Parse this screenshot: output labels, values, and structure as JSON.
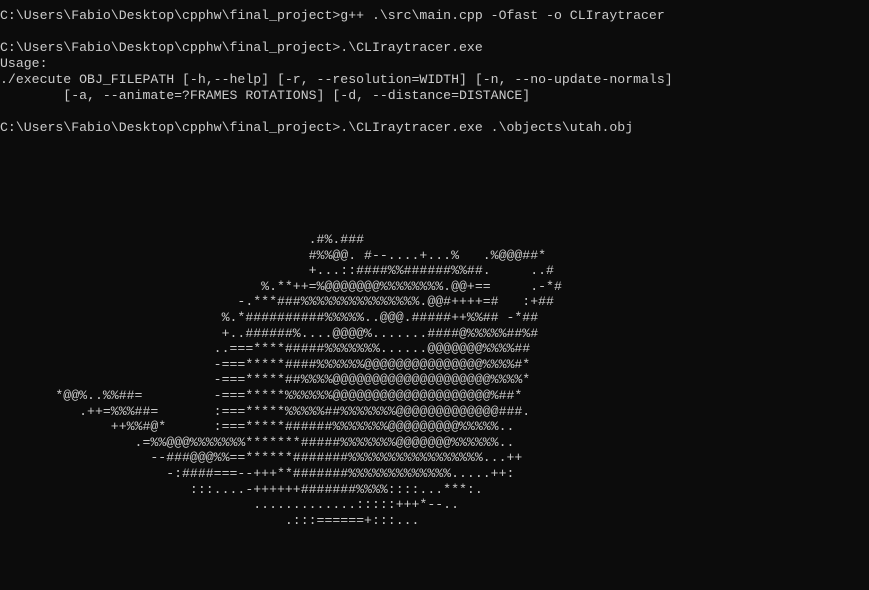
{
  "terminal": {
    "lines": [
      "C:\\Users\\Fabio\\Desktop\\cpphw\\final_project>g++ .\\src\\main.cpp -Ofast -o CLIraytracer",
      "",
      "C:\\Users\\Fabio\\Desktop\\cpphw\\final_project>.\\CLIraytracer.exe",
      "Usage:",
      "./execute OBJ_FILEPATH [-h,--help] [-r, --resolution=WIDTH] [-n, --no-update-normals]",
      "        [-a, --animate=?FRAMES ROTATIONS] [-d, --distance=DISTANCE]",
      "",
      "C:\\Users\\Fabio\\Desktop\\cpphw\\final_project>.\\CLIraytracer.exe .\\objects\\utah.obj"
    ],
    "ascii_render": [
      "                                       .#%.###",
      "                                       #%%@@. #--....+...%   .%@@@##*",
      "                                       +...::####%%######%%##.     ..#",
      "                                 %.**++=%@@@@@@@%%%%%%%%.@@+==     .-*#",
      "                              -.***###%%%%%%%%%%%%%%%.@@#++++=#   :+##",
      "                            %.*##########%%%%%..@@@.#####++%%## -*##",
      "                            +..######%....@@@@%.......####@%%%%%##%#",
      "                           ..===****#####%%%%%%%......@@@@@@@%%%%##",
      "                           -===*****####%%%%%%@@@@@@@@@@@@@@@%%%%#*",
      "                           -===*****##%%%%@@@@@@@@@@@@@@@@@@@@%%%%*",
      "       *@@%..%%##=         -===*****%%%%%%@@@@@@@@@@@@@@@@@@@@%##*",
      "          .++=%%%##=       :===*****%%%%%##%%%%%%%@@@@@@@@@@@@@###.",
      "              ++%%#@*      :===*****######%%%%%%%@@@@@@@@@%%%%%..",
      "                 .=%%@@@%%%%%%%*******#####%%%%%%%@@@@@@@%%%%%%..",
      "                   --###@@@%%==******#######%%%%%%%%%%%%%%%%%...++",
      "                     -:####===--+++**#######%%%%%%%%%%%%%.....++:",
      "                        :::....-++++++#######%%%%::::...***:.",
      "                                .............:::::+++*--..",
      "                                    .:::======+:::..."
    ]
  }
}
